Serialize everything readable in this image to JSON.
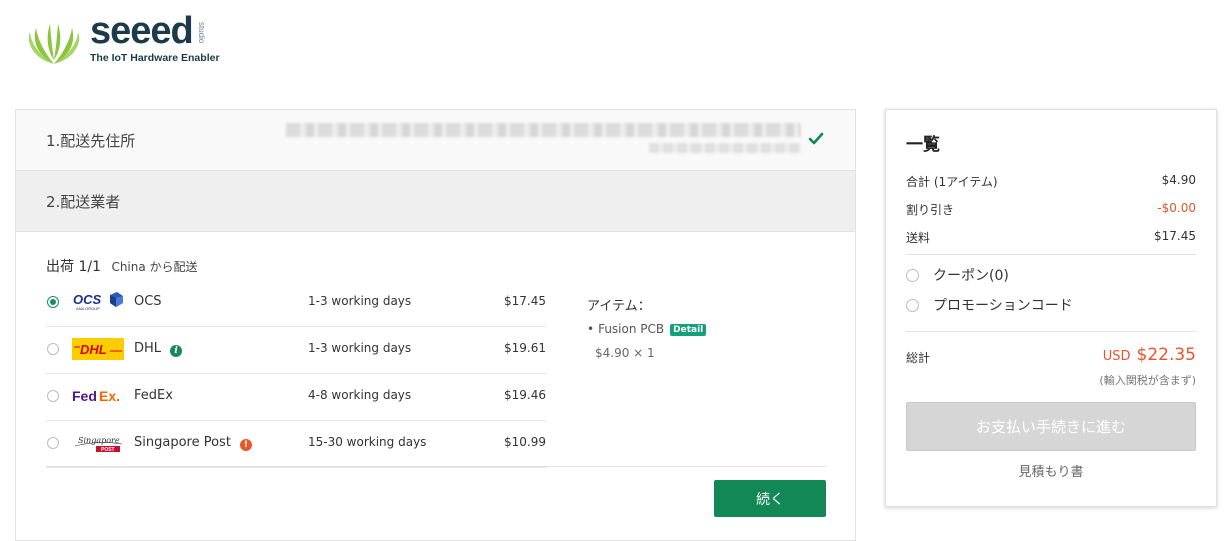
{
  "brand": {
    "name": "seeed",
    "tagline": "The IoT Hardware Enabler",
    "sub": "studio"
  },
  "steps": {
    "address_title": "1.配送先住所",
    "carrier_title": "2.配送業者"
  },
  "shipment": {
    "title": "出荷 1/1",
    "origin": "China から配送"
  },
  "carriers": [
    {
      "name": "OCS",
      "days": "1-3 working days",
      "price": "$17.45",
      "selected": true,
      "badge": ""
    },
    {
      "name": "DHL",
      "days": "1-3 working days",
      "price": "$19.61",
      "selected": false,
      "badge": "i"
    },
    {
      "name": "FedEx",
      "days": "4-8 working days",
      "price": "$19.46",
      "selected": false,
      "badge": ""
    },
    {
      "name": "Singapore Post",
      "days": "15-30 working days",
      "price": "$10.99",
      "selected": false,
      "badge": "!"
    }
  ],
  "carrier_logos": {
    "ocs": "OCS",
    "ocs_sub": "ANA GROUP",
    "dhl": "DHL",
    "fedex_a": "Fed",
    "fedex_b": "Ex.",
    "sgpost": "Singapore",
    "sgpost_sub": "POST"
  },
  "items": {
    "heading": "アイテム：",
    "name": "Fusion PCB",
    "detail_label": "Detail",
    "qty": "$4.90 × 1"
  },
  "continue_label": "続く",
  "summary": {
    "title": "一覧",
    "subtotal_label": "合計 (1アイテム)",
    "subtotal": "$4.90",
    "discount_label": "割り引き",
    "discount": "-$0.00",
    "shipping_label": "送料",
    "shipping": "$17.45",
    "coupon_label": "クーポン(0)",
    "promo_label": "プロモーションコード",
    "total_label": "総計",
    "currency": "USD",
    "total": "$22.35",
    "tax_note": "(輸入関税が含まず)",
    "pay_label": "お支払い手続きに進む",
    "quote_label": "見積もり書"
  },
  "colors": {
    "accent_green": "#138857",
    "price_red": "#e8552d",
    "logo_green": "#8cc63f",
    "logo_navy": "#1d3a4a"
  },
  "icons": [
    "check-icon",
    "info-icon",
    "alert-icon"
  ]
}
